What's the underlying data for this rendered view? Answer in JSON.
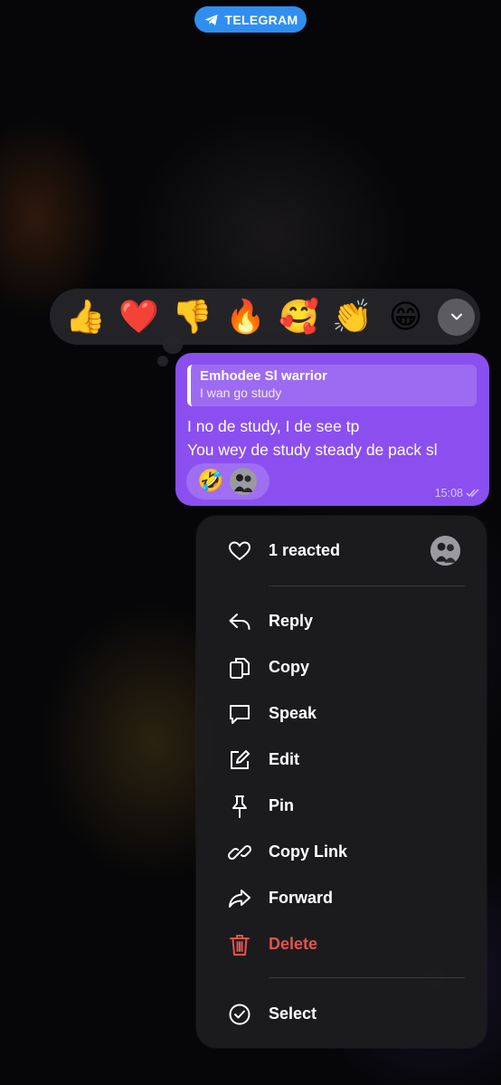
{
  "badge": {
    "label": "TELEGRAM"
  },
  "reactions": [
    "👍",
    "❤️",
    "👎",
    "🔥",
    "🥰",
    "👏",
    "😁"
  ],
  "message": {
    "reply_name": "Emhodee Sl warrior",
    "reply_text": "I wan go study",
    "line1": "I no de study, I de see tp",
    "line2": "You wey de study steady de pack sl",
    "reaction_emoji": "🤣",
    "time": "15:08"
  },
  "menu": {
    "reacted": "1 reacted",
    "items": [
      {
        "label": "Reply",
        "icon": "reply-icon"
      },
      {
        "label": "Copy",
        "icon": "copy-icon"
      },
      {
        "label": "Speak",
        "icon": "speech-bubble-icon"
      },
      {
        "label": "Edit",
        "icon": "edit-icon"
      },
      {
        "label": "Pin",
        "icon": "pin-icon"
      },
      {
        "label": "Copy Link",
        "icon": "link-icon"
      },
      {
        "label": "Forward",
        "icon": "forward-icon"
      },
      {
        "label": "Delete",
        "icon": "trash-icon"
      }
    ],
    "select": "Select"
  },
  "colors": {
    "bubble": "#8b4ff0",
    "badge": "#2f8ef0",
    "danger": "#e5534b",
    "menu_bg": "#1c1c1e"
  }
}
